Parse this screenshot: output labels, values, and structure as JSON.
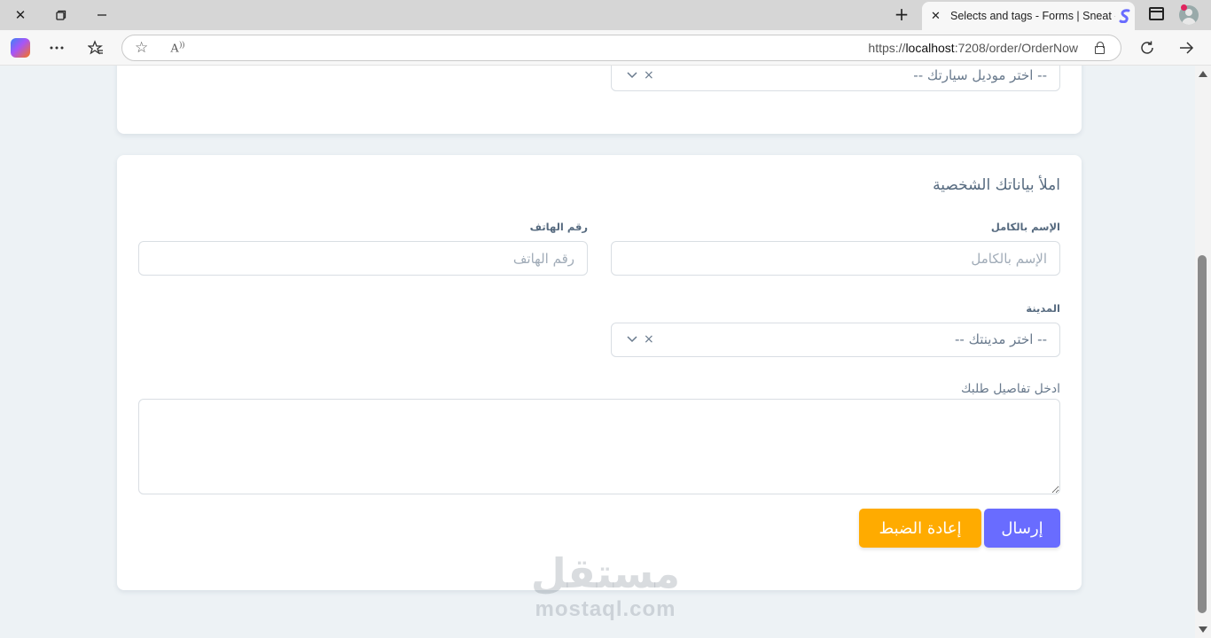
{
  "browser": {
    "tab_title": "Selects and tags - Forms | Sneat -",
    "url_prefix": "https://",
    "url_host": "localhost",
    "url_rest": ":7208/order/OrderNow",
    "close_glyph": "✕",
    "new_tab_glyph": "+",
    "icons": [
      "close-icon",
      "restore-icon",
      "minimize-icon",
      "new-tab-icon",
      "split-screen-icon",
      "profile-icon",
      "copilot-icon",
      "more-icon",
      "favorites-icon",
      "star-icon",
      "read-aloud-icon",
      "lock-icon",
      "refresh-icon",
      "forward-icon"
    ]
  },
  "car_model_select": {
    "placeholder": "-- اختر موديل سيارتك --",
    "clear": "×"
  },
  "personal": {
    "title": "املأ بياناتك الشخصية",
    "full_name_label": "الإسم بالكامل",
    "full_name_placeholder": "الإسم بالكامل",
    "phone_label": "رقم الهاتف",
    "phone_placeholder": "رقم الهاتف",
    "city_label": "المدينة",
    "city_placeholder": "-- اختر مدينتك --",
    "city_clear": "×",
    "details_label": "ادخل تفاصيل طلبك",
    "details_value": ""
  },
  "actions": {
    "submit_label": "إرسال",
    "reset_label": "إعادة الضبط"
  },
  "watermark": {
    "arabic": "مستقل",
    "latin": "mostaql.com"
  },
  "colors": {
    "primary": "#696cff",
    "warning": "#ffab00",
    "page_bg": "#edf2f5",
    "text": "#566a7f"
  }
}
